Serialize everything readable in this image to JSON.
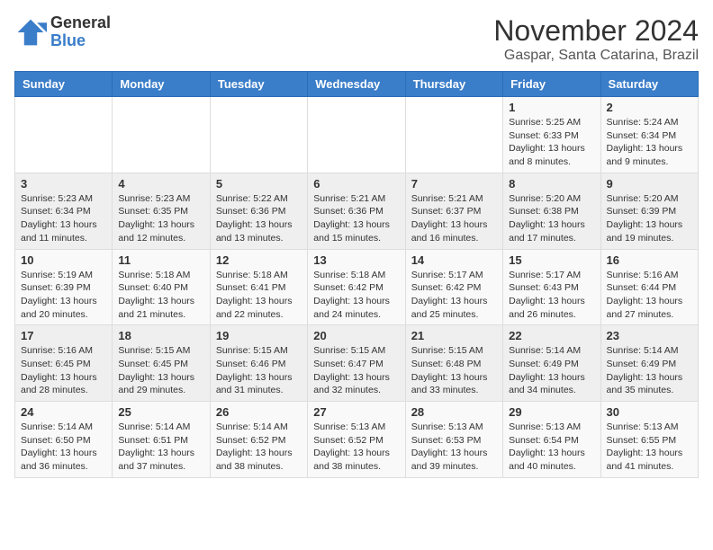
{
  "logo": {
    "general": "General",
    "blue": "Blue"
  },
  "title": "November 2024",
  "location": "Gaspar, Santa Catarina, Brazil",
  "weekdays": [
    "Sunday",
    "Monday",
    "Tuesday",
    "Wednesday",
    "Thursday",
    "Friday",
    "Saturday"
  ],
  "weeks": [
    [
      {
        "day": "",
        "info": ""
      },
      {
        "day": "",
        "info": ""
      },
      {
        "day": "",
        "info": ""
      },
      {
        "day": "",
        "info": ""
      },
      {
        "day": "",
        "info": ""
      },
      {
        "day": "1",
        "info": "Sunrise: 5:25 AM\nSunset: 6:33 PM\nDaylight: 13 hours and 8 minutes."
      },
      {
        "day": "2",
        "info": "Sunrise: 5:24 AM\nSunset: 6:34 PM\nDaylight: 13 hours and 9 minutes."
      }
    ],
    [
      {
        "day": "3",
        "info": "Sunrise: 5:23 AM\nSunset: 6:34 PM\nDaylight: 13 hours and 11 minutes."
      },
      {
        "day": "4",
        "info": "Sunrise: 5:23 AM\nSunset: 6:35 PM\nDaylight: 13 hours and 12 minutes."
      },
      {
        "day": "5",
        "info": "Sunrise: 5:22 AM\nSunset: 6:36 PM\nDaylight: 13 hours and 13 minutes."
      },
      {
        "day": "6",
        "info": "Sunrise: 5:21 AM\nSunset: 6:36 PM\nDaylight: 13 hours and 15 minutes."
      },
      {
        "day": "7",
        "info": "Sunrise: 5:21 AM\nSunset: 6:37 PM\nDaylight: 13 hours and 16 minutes."
      },
      {
        "day": "8",
        "info": "Sunrise: 5:20 AM\nSunset: 6:38 PM\nDaylight: 13 hours and 17 minutes."
      },
      {
        "day": "9",
        "info": "Sunrise: 5:20 AM\nSunset: 6:39 PM\nDaylight: 13 hours and 19 minutes."
      }
    ],
    [
      {
        "day": "10",
        "info": "Sunrise: 5:19 AM\nSunset: 6:39 PM\nDaylight: 13 hours and 20 minutes."
      },
      {
        "day": "11",
        "info": "Sunrise: 5:18 AM\nSunset: 6:40 PM\nDaylight: 13 hours and 21 minutes."
      },
      {
        "day": "12",
        "info": "Sunrise: 5:18 AM\nSunset: 6:41 PM\nDaylight: 13 hours and 22 minutes."
      },
      {
        "day": "13",
        "info": "Sunrise: 5:18 AM\nSunset: 6:42 PM\nDaylight: 13 hours and 24 minutes."
      },
      {
        "day": "14",
        "info": "Sunrise: 5:17 AM\nSunset: 6:42 PM\nDaylight: 13 hours and 25 minutes."
      },
      {
        "day": "15",
        "info": "Sunrise: 5:17 AM\nSunset: 6:43 PM\nDaylight: 13 hours and 26 minutes."
      },
      {
        "day": "16",
        "info": "Sunrise: 5:16 AM\nSunset: 6:44 PM\nDaylight: 13 hours and 27 minutes."
      }
    ],
    [
      {
        "day": "17",
        "info": "Sunrise: 5:16 AM\nSunset: 6:45 PM\nDaylight: 13 hours and 28 minutes."
      },
      {
        "day": "18",
        "info": "Sunrise: 5:15 AM\nSunset: 6:45 PM\nDaylight: 13 hours and 29 minutes."
      },
      {
        "day": "19",
        "info": "Sunrise: 5:15 AM\nSunset: 6:46 PM\nDaylight: 13 hours and 31 minutes."
      },
      {
        "day": "20",
        "info": "Sunrise: 5:15 AM\nSunset: 6:47 PM\nDaylight: 13 hours and 32 minutes."
      },
      {
        "day": "21",
        "info": "Sunrise: 5:15 AM\nSunset: 6:48 PM\nDaylight: 13 hours and 33 minutes."
      },
      {
        "day": "22",
        "info": "Sunrise: 5:14 AM\nSunset: 6:49 PM\nDaylight: 13 hours and 34 minutes."
      },
      {
        "day": "23",
        "info": "Sunrise: 5:14 AM\nSunset: 6:49 PM\nDaylight: 13 hours and 35 minutes."
      }
    ],
    [
      {
        "day": "24",
        "info": "Sunrise: 5:14 AM\nSunset: 6:50 PM\nDaylight: 13 hours and 36 minutes."
      },
      {
        "day": "25",
        "info": "Sunrise: 5:14 AM\nSunset: 6:51 PM\nDaylight: 13 hours and 37 minutes."
      },
      {
        "day": "26",
        "info": "Sunrise: 5:14 AM\nSunset: 6:52 PM\nDaylight: 13 hours and 38 minutes."
      },
      {
        "day": "27",
        "info": "Sunrise: 5:13 AM\nSunset: 6:52 PM\nDaylight: 13 hours and 38 minutes."
      },
      {
        "day": "28",
        "info": "Sunrise: 5:13 AM\nSunset: 6:53 PM\nDaylight: 13 hours and 39 minutes."
      },
      {
        "day": "29",
        "info": "Sunrise: 5:13 AM\nSunset: 6:54 PM\nDaylight: 13 hours and 40 minutes."
      },
      {
        "day": "30",
        "info": "Sunrise: 5:13 AM\nSunset: 6:55 PM\nDaylight: 13 hours and 41 minutes."
      }
    ]
  ]
}
